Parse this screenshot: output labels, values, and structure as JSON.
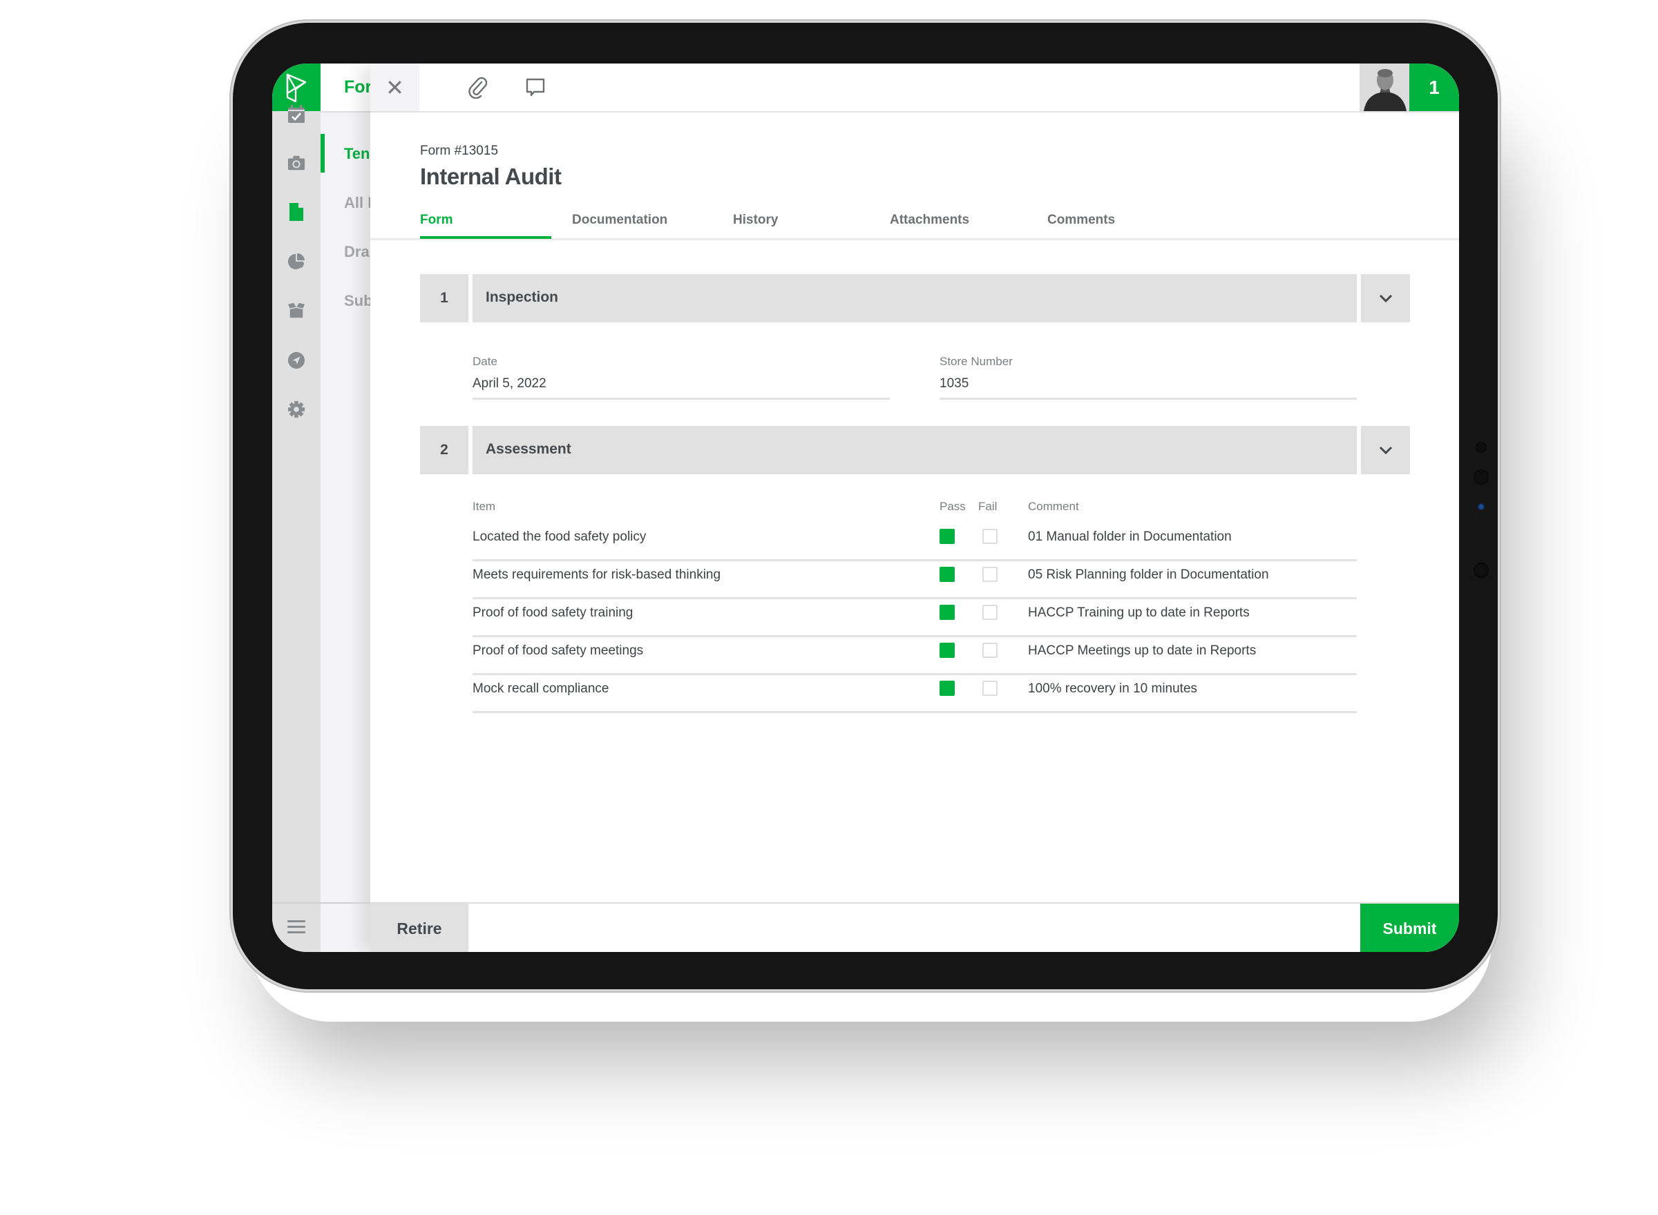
{
  "app": {
    "brand_color": "#00b140",
    "logo_icon": "p-logo-icon"
  },
  "rail": {
    "items": [
      {
        "icon": "calendar-check-icon",
        "active": false
      },
      {
        "icon": "camera-icon",
        "active": false
      },
      {
        "icon": "document-icon",
        "active": true
      },
      {
        "icon": "pie-chart-icon",
        "active": false
      },
      {
        "icon": "open-box-icon",
        "active": false
      },
      {
        "icon": "navigation-arrow-icon",
        "active": false
      },
      {
        "icon": "gear-icon",
        "active": false
      }
    ],
    "menu_icon": "hamburger-menu-icon"
  },
  "list": {
    "title": "For",
    "items": [
      {
        "label": "Ten",
        "active": true
      },
      {
        "label": "All F",
        "active": false
      },
      {
        "label": "Dra",
        "active": false
      },
      {
        "label": "Sub",
        "active": false
      }
    ]
  },
  "topbar": {
    "close_icon": "close-icon",
    "close_glyph": "✕",
    "attach_icon": "paperclip-icon",
    "comment_icon": "comment-icon",
    "notification_count": "1"
  },
  "form": {
    "number": "Form #13015",
    "title": "Internal Audit",
    "tabs": [
      {
        "label": "Form",
        "active": true
      },
      {
        "label": "Documentation",
        "active": false
      },
      {
        "label": "History",
        "active": false
      },
      {
        "label": "Attachments",
        "active": false
      },
      {
        "label": "Comments",
        "active": false
      }
    ],
    "sections": [
      {
        "number": "1",
        "title": "Inspection",
        "expanded": true
      },
      {
        "number": "2",
        "title": "Assessment",
        "expanded": true
      }
    ],
    "inspection": {
      "date_label": "Date",
      "date_value": "April 5, 2022",
      "store_label": "Store Number",
      "store_value": "1035"
    },
    "assessment": {
      "headers": {
        "item": "Item",
        "pass": "Pass",
        "fail": "Fail",
        "comment": "Comment"
      },
      "rows": [
        {
          "item": "Located the food safety policy",
          "pass": true,
          "fail": false,
          "comment": "01 Manual folder in Documentation"
        },
        {
          "item": "Meets requirements for risk-based thinking",
          "pass": true,
          "fail": false,
          "comment": "05 Risk Planning folder in Documentation"
        },
        {
          "item": "Proof of food safety training",
          "pass": true,
          "fail": false,
          "comment": "HACCP Training up to date in Reports"
        },
        {
          "item": "Proof of food safety meetings",
          "pass": true,
          "fail": false,
          "comment": "HACCP Meetings up to date in Reports"
        },
        {
          "item": "Mock recall compliance",
          "pass": true,
          "fail": false,
          "comment": "100% recovery in 10 minutes"
        }
      ]
    }
  },
  "footer": {
    "retire_label": "Retire",
    "submit_label": "Submit"
  }
}
